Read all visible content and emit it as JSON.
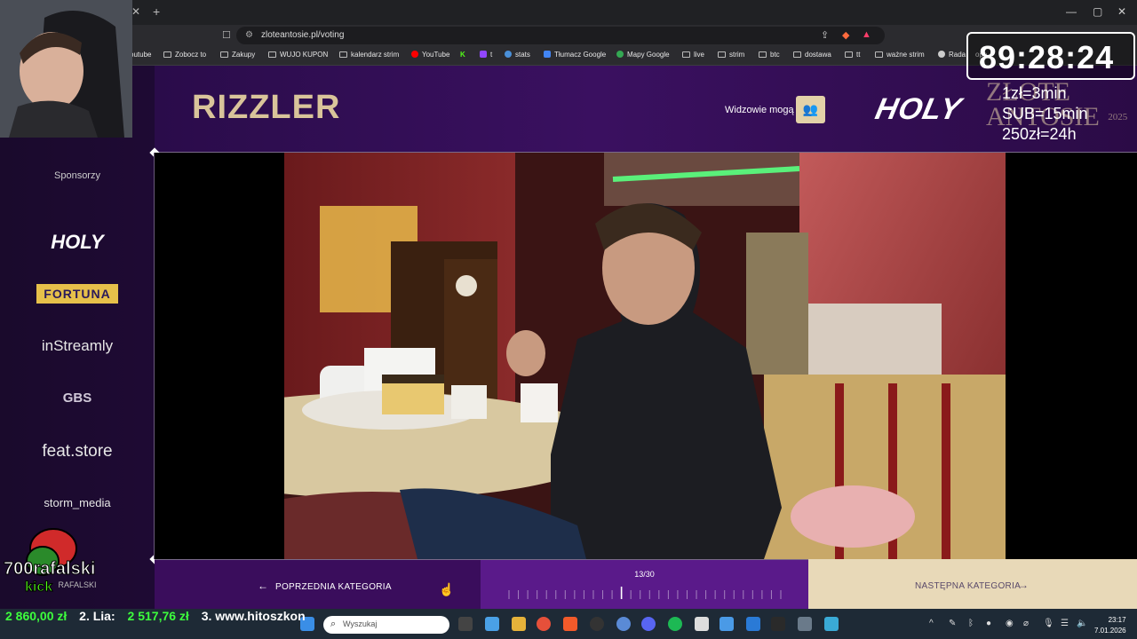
{
  "browser": {
    "url": "zloteantosie.pl/voting",
    "bookmarks": [
      {
        "label": "outube",
        "icon": "folder"
      },
      {
        "label": "Zobocz to",
        "icon": "folder"
      },
      {
        "label": "Zakupy",
        "icon": "folder"
      },
      {
        "label": "WUJO KUPON",
        "icon": "folder"
      },
      {
        "label": "kalendarz strim",
        "icon": "folder"
      },
      {
        "label": "YouTube",
        "icon": "youtube"
      },
      {
        "label": "t",
        "icon": "twitch"
      },
      {
        "label": "stats",
        "icon": "link"
      },
      {
        "label": "Tłumacz Google",
        "icon": "translate"
      },
      {
        "label": "Mapy Google",
        "icon": "maps"
      },
      {
        "label": "live",
        "icon": "folder"
      },
      {
        "label": "strim",
        "icon": "folder"
      },
      {
        "label": "btc",
        "icon": "folder"
      },
      {
        "label": "dostawa",
        "icon": "folder"
      },
      {
        "label": "tt",
        "icon": "folder"
      },
      {
        "label": "ważne strim",
        "icon": "folder"
      },
      {
        "label": "Rada",
        "icon": "drop"
      },
      {
        "label": "ope",
        "icon": "folder"
      }
    ]
  },
  "header": {
    "category_title": "RIZZLER",
    "viewers_label": "Widzowie mogą",
    "sponsor_logo": "HOLY",
    "event_logo": "ZŁOTE ANTOSIE",
    "event_year": "2025"
  },
  "sidebar": {
    "sponsors_label": "Sponsorzy",
    "sponsors": [
      "HOLY",
      "FORTUNA",
      "inStreamly",
      "GBS",
      "feat.store",
      "storm_media",
      "RAFALSKI"
    ]
  },
  "footer": {
    "prev_label": "POPRZEDNIA KATEGORIA",
    "next_label": "NASTĘPNA KATEGORIA",
    "progress_text": "13/30",
    "progress_current": 13,
    "progress_total": 30
  },
  "overlay": {
    "timer": "89:28:24",
    "rates": [
      "1zł=3min",
      "SUB=15min",
      "250zł=24h"
    ],
    "ticker": [
      {
        "text": "2 860,00 zł",
        "color": "#3dff3d"
      },
      {
        "text": "2. Lia:",
        "color": "#ffffff"
      },
      {
        "text": "2 517,76 zł",
        "color": "#3dff3d"
      },
      {
        "text": "3. www.hitoszkon",
        "color": "#ffffff"
      }
    ],
    "logo_text": "700rafalski",
    "logo_sub": "kick"
  },
  "taskbar": {
    "search_placeholder": "Wyszukaj",
    "time": "23:17",
    "date": "7.01.2026"
  },
  "colors": {
    "accent_gold": "#d9c49a",
    "purple": "#3a0d5c",
    "progress_purple": "#5a1a8a",
    "next_bg": "#e8d9b8"
  }
}
